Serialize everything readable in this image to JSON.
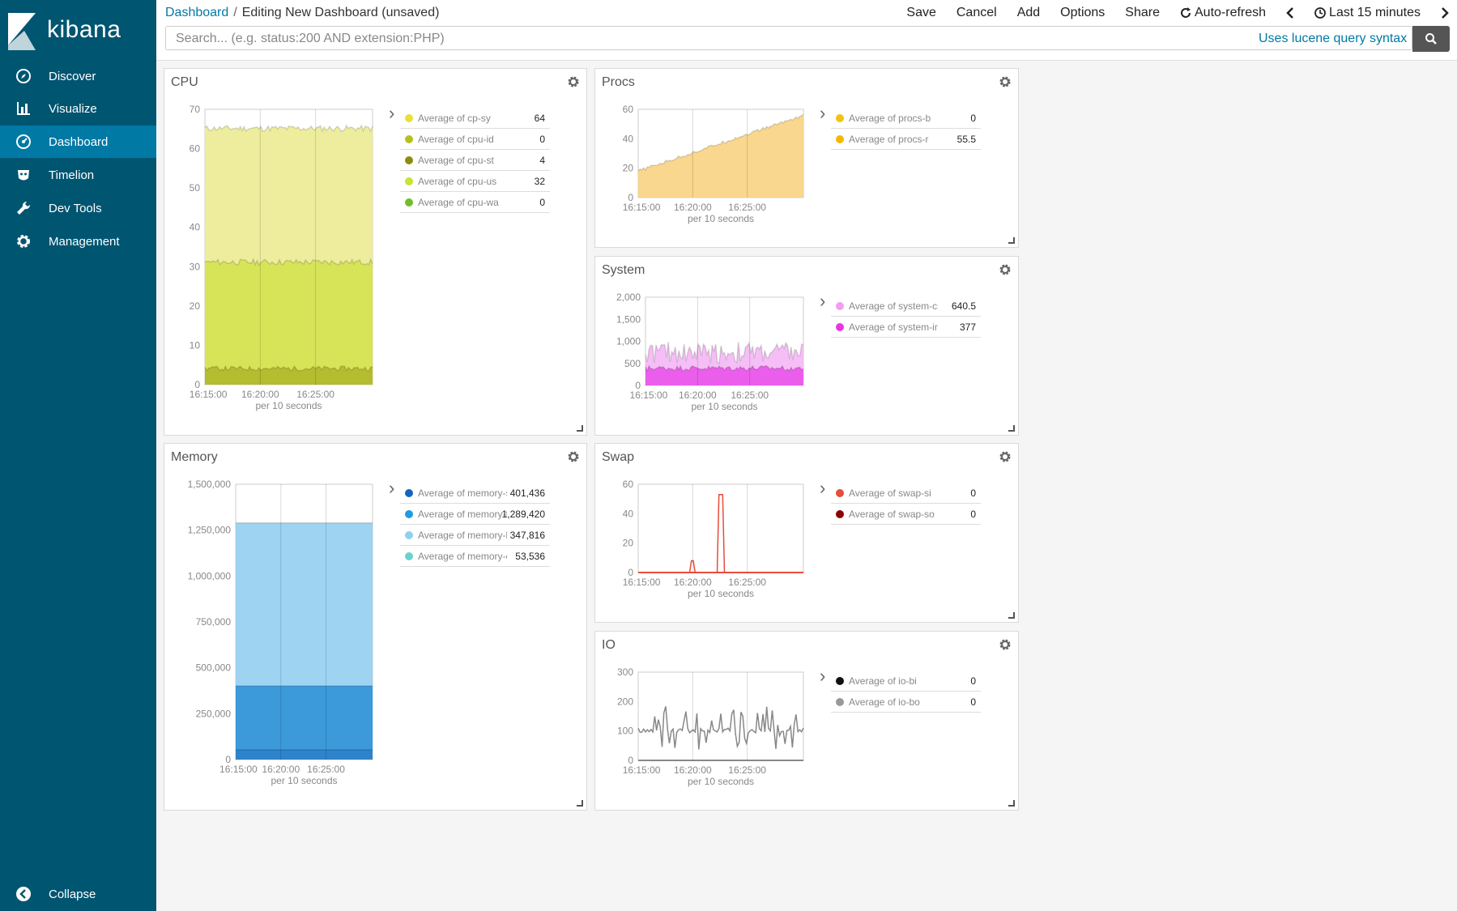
{
  "app": {
    "name": "kibana"
  },
  "sidebar": {
    "items": [
      {
        "label": "Discover",
        "icon": "compass-icon"
      },
      {
        "label": "Visualize",
        "icon": "bar-chart-icon"
      },
      {
        "label": "Dashboard",
        "icon": "dashboard-icon",
        "active": true
      },
      {
        "label": "Timelion",
        "icon": "timelion-icon"
      },
      {
        "label": "Dev Tools",
        "icon": "wrench-icon"
      },
      {
        "label": "Management",
        "icon": "gear-icon"
      }
    ],
    "collapse_label": "Collapse"
  },
  "breadcrumb": {
    "root": "Dashboard",
    "sep": "/",
    "current": "Editing New Dashboard (unsaved)"
  },
  "toolbar": {
    "save": "Save",
    "cancel": "Cancel",
    "add": "Add",
    "options": "Options",
    "share": "Share",
    "auto_refresh": "Auto-refresh",
    "time_range": "Last 15 minutes"
  },
  "search": {
    "placeholder": "Search... (e.g. status:200 AND extension:PHP)",
    "syntax_link": "Uses lucene query syntax"
  },
  "colors": {
    "sidebar": "#005571",
    "active": "#0079a5"
  },
  "panels": {
    "cpu": {
      "title": "CPU",
      "legend": [
        {
          "label": "Average of cp-sy",
          "value": "64",
          "color": "#e7e03c"
        },
        {
          "label": "Average of cpu-id",
          "value": "0",
          "color": "#b5c21c"
        },
        {
          "label": "Average of cpu-st",
          "value": "4",
          "color": "#8a8d10"
        },
        {
          "label": "Average of cpu-us",
          "value": "32",
          "color": "#c9e235"
        },
        {
          "label": "Average of cpu-wa",
          "value": "0",
          "color": "#6fbf2a"
        }
      ]
    },
    "procs": {
      "title": "Procs",
      "legend": [
        {
          "label": "Average of procs-b",
          "value": "0",
          "color": "#f1c40f"
        },
        {
          "label": "Average of procs-r",
          "value": "55.5",
          "color": "#f5b800"
        }
      ]
    },
    "system": {
      "title": "System",
      "legend": [
        {
          "label": "Average of system-cs",
          "value": "640.5",
          "color": "#f39cf2"
        },
        {
          "label": "Average of system-in",
          "value": "377",
          "color": "#e636e6"
        }
      ]
    },
    "memory": {
      "title": "Memory",
      "legend": [
        {
          "label": "Average of memory-swpd",
          "value": "401,436",
          "color": "#1565c0"
        },
        {
          "label": "Average of memory-free",
          "value": "1,289,420",
          "color": "#1f9be0"
        },
        {
          "label": "Average of memory-buff",
          "value": "347,816",
          "color": "#8fd0f0"
        },
        {
          "label": "Average of memory-cache",
          "value": "53,536",
          "color": "#6bd1cf"
        }
      ]
    },
    "swap": {
      "title": "Swap",
      "legend": [
        {
          "label": "Average of swap-si",
          "value": "0",
          "color": "#e74c3c"
        },
        {
          "label": "Average of swap-so",
          "value": "0",
          "color": "#8b0000"
        }
      ]
    },
    "io": {
      "title": "IO",
      "legend": [
        {
          "label": "Average of io-bi",
          "value": "0",
          "color": "#111111"
        },
        {
          "label": "Average of io-bo",
          "value": "0",
          "color": "#999999"
        }
      ]
    }
  },
  "chart_data": [
    {
      "id": "cpu",
      "type": "area",
      "title": "CPU",
      "x_ticks": [
        "16:15:00",
        "16:20:00",
        "16:25:00"
      ],
      "xlabel": "per 10 seconds",
      "ylim": [
        0,
        70
      ],
      "y_ticks": [
        "0",
        "10",
        "20",
        "30",
        "40",
        "50",
        "60",
        "70"
      ],
      "series": [
        {
          "name": "Average of cpu-st",
          "level": 4,
          "color": "#aeb528",
          "noise": 1.2
        },
        {
          "name": "Average of cpu-us",
          "level": 31,
          "color": "#d2e24c",
          "noise": 1.5
        },
        {
          "name": "Average of cp-sy",
          "level": 65,
          "color": "#eaea8c",
          "noise": 1.5
        }
      ]
    },
    {
      "id": "procs",
      "type": "area",
      "title": "Procs",
      "x_ticks": [
        "16:15:00",
        "16:20:00",
        "16:25:00"
      ],
      "xlabel": "per 10 seconds",
      "ylim": [
        0,
        60
      ],
      "y_ticks": [
        "0",
        "20",
        "40",
        "60"
      ],
      "series": [
        {
          "name": "Average of procs-r",
          "start": 18,
          "end": 56,
          "color": "#f8d07a"
        }
      ]
    },
    {
      "id": "system",
      "type": "area",
      "title": "System",
      "x_ticks": [
        "16:15:00",
        "16:20:00",
        "16:25:00"
      ],
      "xlabel": "per 10 seconds",
      "ylim": [
        0,
        2000
      ],
      "y_ticks": [
        "0",
        "500",
        "1,000",
        "1,500",
        "2,000"
      ],
      "series": [
        {
          "name": "Average of system-in",
          "level": 380,
          "color": "#e94ee9",
          "noise": 120
        },
        {
          "name": "Average of system-cs",
          "level": 700,
          "color": "#f5b3f5",
          "noise": 500
        }
      ]
    },
    {
      "id": "memory",
      "type": "area",
      "title": "Memory",
      "x_ticks": [
        "16:15:00",
        "16:20:00",
        "16:25:00"
      ],
      "xlabel": "per 10 seconds",
      "ylim": [
        0,
        1500000
      ],
      "y_ticks": [
        "0",
        "250,000",
        "500,000",
        "750,000",
        "1,000,000",
        "1,250,000",
        "1,500,000"
      ],
      "series": [
        {
          "name": "Average of memory-cache",
          "level": 53536,
          "color": "#2b7fc7"
        },
        {
          "name": "Average of memory-swpd",
          "level": 401436,
          "color": "#2a8ed6"
        },
        {
          "name": "Average of memory-free",
          "level": 1289420,
          "color": "#8dcdee"
        }
      ]
    },
    {
      "id": "swap",
      "type": "line",
      "title": "Swap",
      "x_ticks": [
        "16:15:00",
        "16:20:00",
        "16:25:00"
      ],
      "xlabel": "per 10 seconds",
      "ylim": [
        0,
        60
      ],
      "y_ticks": [
        "0",
        "20",
        "40",
        "60"
      ],
      "series": [
        {
          "name": "Average of swap-si",
          "spikes": [
            [
              0.33,
              8
            ],
            [
              0.5,
              53
            ]
          ],
          "color": "#e74c3c"
        }
      ]
    },
    {
      "id": "io",
      "type": "line",
      "title": "IO",
      "x_ticks": [
        "16:15:00",
        "16:20:00",
        "16:25:00"
      ],
      "xlabel": "per 10 seconds",
      "ylim": [
        0,
        300
      ],
      "y_ticks": [
        "0",
        "100",
        "200",
        "300"
      ],
      "series": [
        {
          "name": "Average of io-bo",
          "level": 100,
          "noise": 160,
          "color": "#888888"
        }
      ]
    }
  ]
}
